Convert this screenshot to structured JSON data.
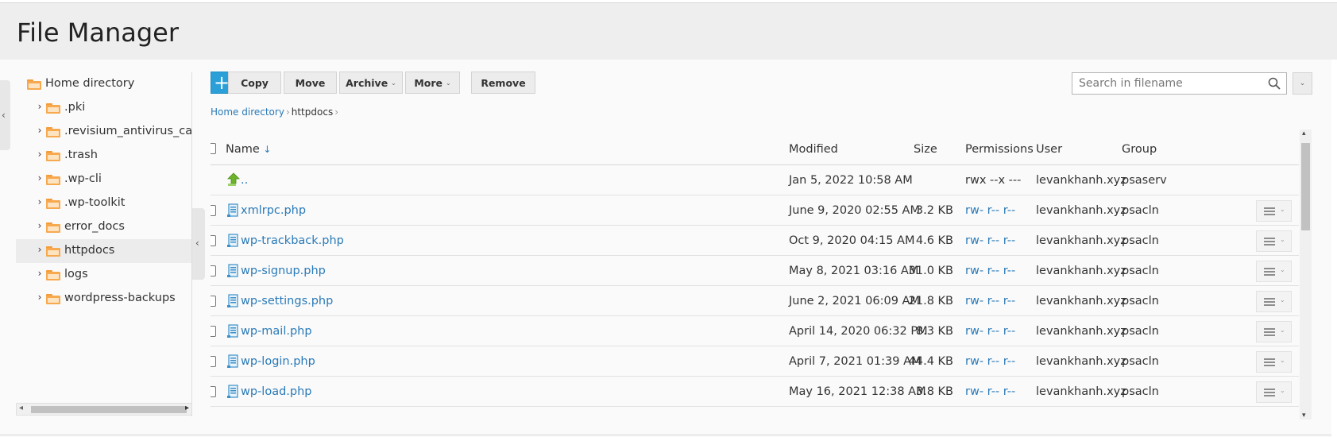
{
  "page": {
    "title": "File Manager"
  },
  "toolbar": {
    "add_label": "+",
    "copy_label": "Copy",
    "move_label": "Move",
    "archive_label": "Archive",
    "more_label": "More",
    "remove_label": "Remove"
  },
  "search": {
    "placeholder": "Search in filename",
    "value": ""
  },
  "breadcrumb": {
    "root": "Home directory",
    "current": "httpdocs"
  },
  "tree": {
    "root_label": "Home directory",
    "items": [
      {
        "label": ".pki"
      },
      {
        "label": ".revisium_antivirus_cache"
      },
      {
        "label": ".trash"
      },
      {
        "label": ".wp-cli"
      },
      {
        "label": ".wp-toolkit"
      },
      {
        "label": "error_docs"
      },
      {
        "label": "httpdocs",
        "selected": true
      },
      {
        "label": "logs"
      },
      {
        "label": "wordpress-backups"
      }
    ]
  },
  "table": {
    "headers": {
      "name": "Name",
      "modified": "Modified",
      "size": "Size",
      "permissions": "Permissions",
      "user": "User",
      "group": "Group"
    },
    "parent_row": {
      "name": "..",
      "modified": "Jan 5, 2022 10:58 AM",
      "size": "",
      "permissions": "rwx --x ---",
      "user": "levankhanh.xyz",
      "group": "psaserv"
    },
    "rows": [
      {
        "name": "xmlrpc.php",
        "modified": "June 9, 2020 02:55 AM",
        "size": "3.2 KB",
        "permissions": "rw- r-- r--",
        "user": "levankhanh.xyz",
        "group": "psacln"
      },
      {
        "name": "wp-trackback.php",
        "modified": "Oct 9, 2020 04:15 AM",
        "size": "4.6 KB",
        "permissions": "rw- r-- r--",
        "user": "levankhanh.xyz",
        "group": "psacln"
      },
      {
        "name": "wp-signup.php",
        "modified": "May 8, 2021 03:16 AM",
        "size": "31.0 KB",
        "permissions": "rw- r-- r--",
        "user": "levankhanh.xyz",
        "group": "psacln"
      },
      {
        "name": "wp-settings.php",
        "modified": "June 2, 2021 06:09 AM",
        "size": "21.8 KB",
        "permissions": "rw- r-- r--",
        "user": "levankhanh.xyz",
        "group": "psacln"
      },
      {
        "name": "wp-mail.php",
        "modified": "April 14, 2020 06:32 PM",
        "size": "8.3 KB",
        "permissions": "rw- r-- r--",
        "user": "levankhanh.xyz",
        "group": "psacln"
      },
      {
        "name": "wp-login.php",
        "modified": "April 7, 2021 01:39 AM",
        "size": "44.4 KB",
        "permissions": "rw- r-- r--",
        "user": "levankhanh.xyz",
        "group": "psacln"
      },
      {
        "name": "wp-load.php",
        "modified": "May 16, 2021 12:38 AM",
        "size": "3.8 KB",
        "permissions": "rw- r-- r--",
        "user": "levankhanh.xyz",
        "group": "psacln"
      }
    ]
  },
  "colors": {
    "accent": "#2a9fd8",
    "link": "#2a7ab8",
    "folder": "#f7a950"
  },
  "icons": {
    "folder": "folder-icon",
    "file": "php-file-icon",
    "parent": "parent-directory-icon",
    "search": "search-icon"
  }
}
